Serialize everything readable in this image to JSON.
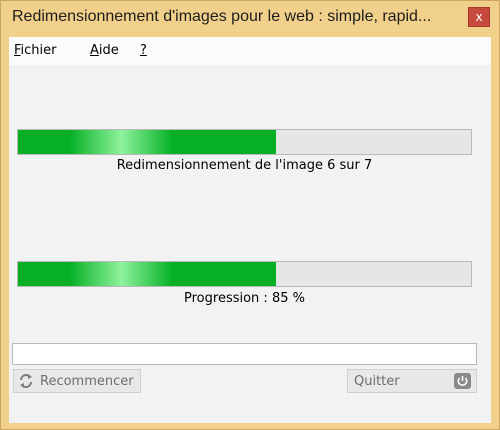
{
  "window": {
    "title": "Redimensionnement d'images pour le web : simple, rapid...",
    "close_label": "x"
  },
  "menu": [
    {
      "mnemonic": "F",
      "rest": "ichier"
    },
    {
      "mnemonic": "A",
      "rest": "ide"
    },
    {
      "mnemonic": "?",
      "rest": ""
    }
  ],
  "image_progress": {
    "text": "Redimensionnement de l'image 6 sur 7",
    "fraction": 0.57
  },
  "overall_progress": {
    "text": "Progression : 85 %",
    "fraction": 0.57
  },
  "log_field": {
    "value": ""
  },
  "buttons": {
    "restart_label": "Recommencer",
    "restart_icon": "refresh-arrows-icon",
    "quit_label": "Quitter",
    "quit_icon": "power-icon"
  },
  "colors": {
    "title_bar": "#f0d08a",
    "close_button": "#c74a3f",
    "progress_fill": "#06b025"
  }
}
